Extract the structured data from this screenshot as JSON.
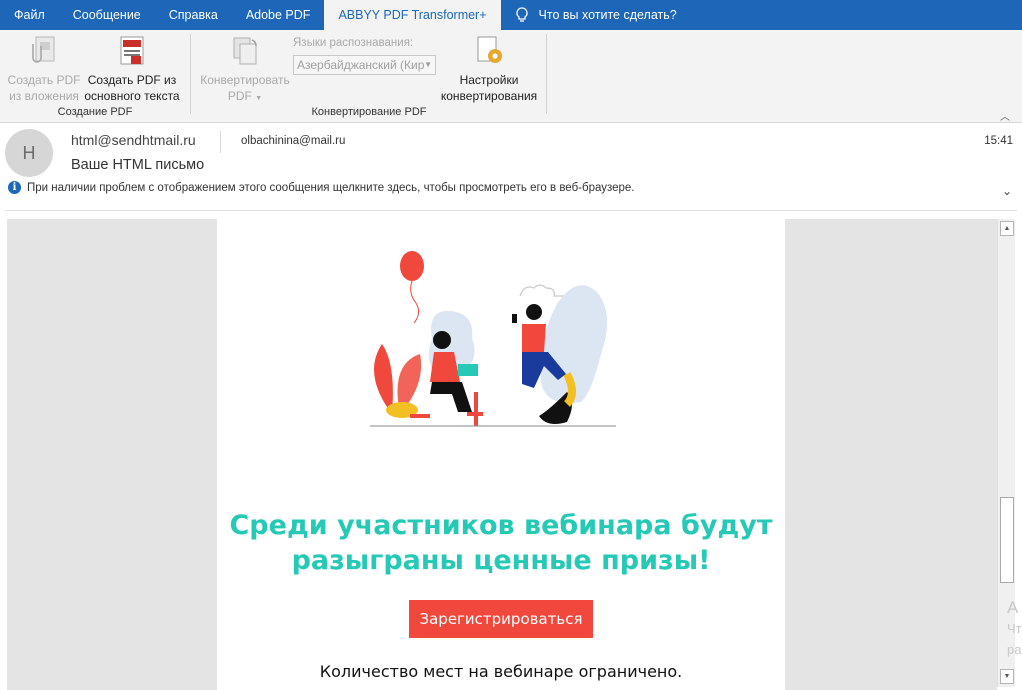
{
  "tabs": [
    {
      "label": "Файл",
      "active": false
    },
    {
      "label": "Сообщение",
      "active": false
    },
    {
      "label": "Справка",
      "active": false
    },
    {
      "label": "Adobe PDF",
      "active": false
    },
    {
      "label": "ABBYY PDF Transformer+",
      "active": true
    }
  ],
  "tell_me": "Что вы хотите сделать?",
  "ribbon": {
    "create_from_attachment": [
      "Создать PDF",
      "из вложения"
    ],
    "create_from_text": [
      "Создать PDF из",
      "основного текста"
    ],
    "group_create": "Создание PDF",
    "convert": [
      "Конвертировать",
      "PDF"
    ],
    "lang_label": "Языки распознавания:",
    "lang_value": "Азербайджанский (Кир",
    "settings": [
      "Настройки",
      "конвертирования"
    ],
    "group_convert": "Конвертирование PDF"
  },
  "message": {
    "avatar_letter": "H",
    "from": "html@sendhtmail.ru",
    "to": "olbachinina@mail.ru",
    "time": "15:41",
    "subject": "Ваше HTML письмо",
    "info": "При наличии проблем с отображением этого сообщения щелкните здесь, чтобы просмотреть его в веб-браузере."
  },
  "email": {
    "headline_1": "Среди участников вебинара будут",
    "headline_2": "разыграны ценные призы!",
    "cta": "Зарегистрироваться",
    "note": "Количество мест на вебинаре ограничено."
  },
  "clipped_text": [
    "А",
    "Чт",
    "ра"
  ],
  "colors": {
    "ribbon_blue": "#1e66b8",
    "headline_teal": "#26c9b6",
    "cta_red": "#f0483c"
  }
}
